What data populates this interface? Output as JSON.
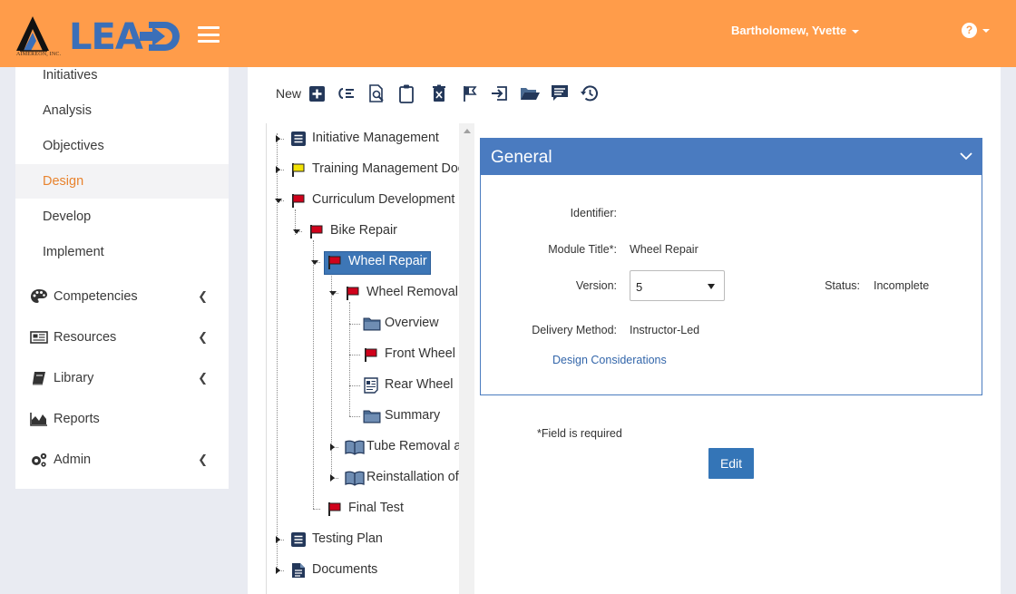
{
  "header": {
    "brand": "LEAD",
    "company": "AIMEREON, INC.",
    "user_name": "Bartholomew, Yvette",
    "help_symbol": "?"
  },
  "sidebar": {
    "items": [
      {
        "label": "Initiatives"
      },
      {
        "label": "Analysis"
      },
      {
        "label": "Objectives"
      },
      {
        "label": "Design",
        "active": true
      },
      {
        "label": "Develop"
      },
      {
        "label": "Implement"
      }
    ],
    "groups": [
      {
        "label": "Competencies",
        "icon": "palette-icon"
      },
      {
        "label": "Resources",
        "icon": "newspaper-icon"
      },
      {
        "label": "Library",
        "icon": "book-icon"
      },
      {
        "label": "Reports",
        "icon": "area-chart-icon"
      },
      {
        "label": "Admin",
        "icon": "gears-icon"
      }
    ]
  },
  "toolbar": {
    "new_label": "New",
    "icons": [
      "plus-square-icon",
      "indent-list-icon",
      "search-document-icon",
      "clipboard-icon",
      "delete-icon",
      "flag-icon",
      "move-icon",
      "folder-open-icon",
      "comment-list-icon",
      "history-icon"
    ]
  },
  "tree": {
    "nodes": [
      {
        "label": "Initiative Management",
        "icon": "document-list-icon"
      },
      {
        "label": "Training Management Doc",
        "icon": "yellow-flag-icon"
      },
      {
        "label": "Curriculum Development",
        "icon": "red-flag-icon"
      },
      {
        "label": "Bike Repair",
        "icon": "red-flag-icon"
      },
      {
        "label": "Wheel Repair",
        "icon": "red-flag-icon",
        "selected": true
      },
      {
        "label": "Wheel Removal",
        "icon": "red-flag-icon"
      },
      {
        "label": "Overview",
        "icon": "folder-icon"
      },
      {
        "label": "Front Wheel",
        "icon": "red-flag-icon"
      },
      {
        "label": "Rear Wheel",
        "icon": "article-icon"
      },
      {
        "label": "Summary",
        "icon": "folder-icon"
      },
      {
        "label": "Tube Removal a",
        "icon": "open-book-icon"
      },
      {
        "label": "Reinstallation of",
        "icon": "open-book-icon"
      },
      {
        "label": "Final Test",
        "icon": "red-flag-icon"
      },
      {
        "label": "Testing Plan",
        "icon": "document-list-icon"
      },
      {
        "label": "Documents",
        "icon": "document-icon"
      }
    ]
  },
  "panel": {
    "title": "General",
    "identifier_label": "Identifier:",
    "identifier_value": "",
    "module_title_label": "Module Title*:",
    "module_title_value": "Wheel Repair",
    "version_label": "Version:",
    "version_value": "5",
    "status_label": "Status:",
    "status_value": "Incomplete",
    "delivery_label": "Delivery Method:",
    "delivery_value": "Instructor-Led",
    "design_link": "Design Considerations"
  },
  "form": {
    "required_note": "*Field is required",
    "edit_label": "Edit"
  },
  "colors": {
    "header": "#ff9c4a",
    "brand_blue": "#3b6fb8",
    "accent_orange": "#e8832e",
    "panel_blue": "#4a7bc0",
    "flag_red": "#d0021b",
    "flag_yellow": "#f2e205",
    "icon_navy": "#24385a"
  }
}
